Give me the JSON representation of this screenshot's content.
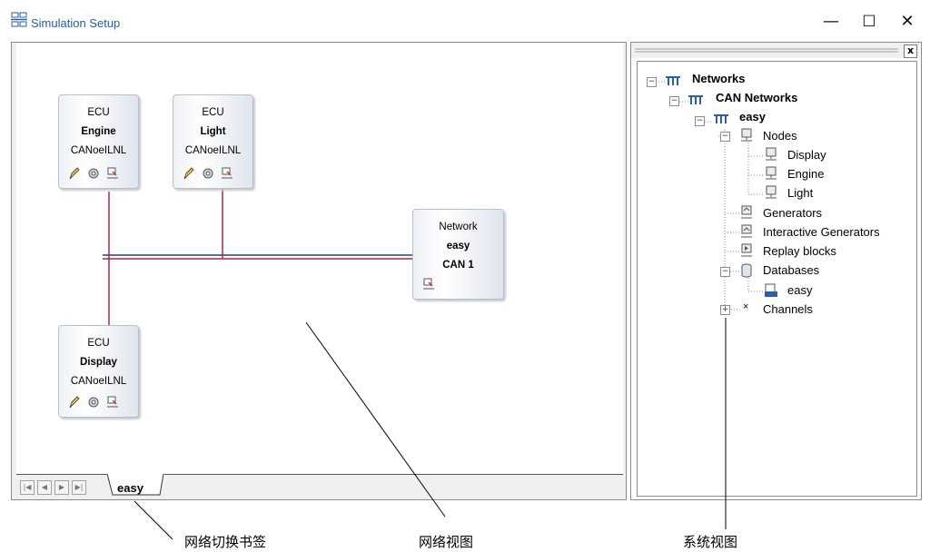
{
  "window": {
    "title": "Simulation Setup",
    "controls": {
      "minimize": "—",
      "maximize": "☐",
      "close": "✕"
    }
  },
  "blocks": {
    "engine": {
      "type": "ECU",
      "name": "Engine",
      "config": "CANoeILNL"
    },
    "light": {
      "type": "ECU",
      "name": "Light",
      "config": "CANoeILNL"
    },
    "display": {
      "type": "ECU",
      "name": "Display",
      "config": "CANoeILNL"
    },
    "network": {
      "type": "Network",
      "name": "easy",
      "bus": "CAN 1"
    }
  },
  "tabs": {
    "active": "easy"
  },
  "tree": {
    "networks": "Networks",
    "can_networks": "CAN Networks",
    "easy": "easy",
    "nodes": "Nodes",
    "node_display": "Display",
    "node_engine": "Engine",
    "node_light": "Light",
    "generators": "Generators",
    "interactive_generators": "Interactive Generators",
    "replay_blocks": "Replay blocks",
    "databases": "Databases",
    "db_easy": "easy",
    "channels": "Channels"
  },
  "captions": {
    "tab_switch": "网络切换书签",
    "network_view": "网络视图",
    "system_view": "系统视图"
  },
  "colors": {
    "bus_blue": "#2a3a8c",
    "bus_red": "#a8264e",
    "title_blue": "#1f5ea8"
  }
}
